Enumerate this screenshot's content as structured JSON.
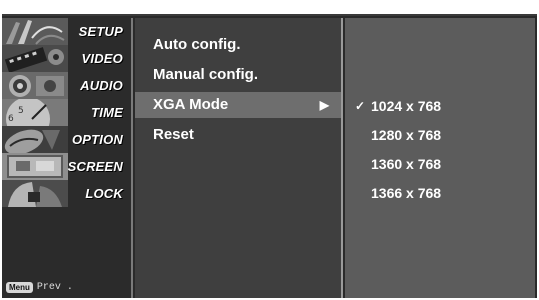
{
  "sidebar": {
    "items": [
      {
        "label": "SETUP",
        "icon": "satellite-dish-icon"
      },
      {
        "label": "VIDEO",
        "icon": "film-reel-icon"
      },
      {
        "label": "AUDIO",
        "icon": "speaker-icon"
      },
      {
        "label": "TIME",
        "icon": "clock-icon"
      },
      {
        "label": "OPTION",
        "icon": "option-badge-icon"
      },
      {
        "label": "SCREEN",
        "icon": "screen-icon"
      },
      {
        "label": "LOCK",
        "icon": "lock-icon"
      }
    ],
    "active_index": 1,
    "hint_key": "Menu",
    "hint_text": "Prev ."
  },
  "menu": {
    "items": [
      {
        "label": "Auto config."
      },
      {
        "label": "Manual config."
      },
      {
        "label": "XGA Mode",
        "arrow": "▶"
      },
      {
        "label": "Reset"
      }
    ],
    "highlight_index": 2
  },
  "submenu": {
    "check": "✓",
    "options": [
      "1024 x 768",
      "1280 x 768",
      "1360 x 768",
      "1366 x 768"
    ],
    "selected_index": 0
  },
  "colors": {
    "sidebar_bg": "#2b2b2b",
    "menu_bg": "#3f3f3f",
    "highlight_bg": "#6e6e6e",
    "submenu_bg": "#5c5c5c",
    "text": "#ffffff"
  }
}
